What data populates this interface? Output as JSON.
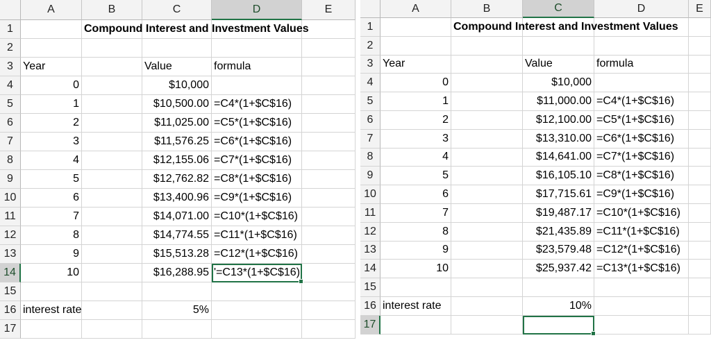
{
  "columns": [
    "A",
    "B",
    "C",
    "D",
    "E"
  ],
  "left": {
    "title": "Compound Interest and Investment Values",
    "header_year": "Year",
    "header_value": "Value",
    "header_formula": "formula",
    "rows": [
      {
        "year": "0",
        "value": "$10,000",
        "formula": ""
      },
      {
        "year": "1",
        "value": "$10,500.00",
        "formula": "=C4*(1+$C$16)"
      },
      {
        "year": "2",
        "value": "$11,025.00",
        "formula": "=C5*(1+$C$16)"
      },
      {
        "year": "3",
        "value": "$11,576.25",
        "formula": "=C6*(1+$C$16)"
      },
      {
        "year": "4",
        "value": "$12,155.06",
        "formula": "=C7*(1+$C$16)"
      },
      {
        "year": "5",
        "value": "$12,762.82",
        "formula": "=C8*(1+$C$16)"
      },
      {
        "year": "6",
        "value": "$13,400.96",
        "formula": "=C9*(1+$C$16)"
      },
      {
        "year": "7",
        "value": "$14,071.00",
        "formula": "=C10*(1+$C$16)"
      },
      {
        "year": "8",
        "value": "$14,774.55",
        "formula": "=C11*(1+$C$16)"
      },
      {
        "year": "9",
        "value": "$15,513.28",
        "formula": "=C12*(1+$C$16)"
      },
      {
        "year": "10",
        "value": "$16,288.95",
        "formula": "'=C13*(1+$C$16)"
      }
    ],
    "rate_label": "interest rate",
    "rate_value": "5%"
  },
  "right": {
    "title": "Compound Interest and Investment Values",
    "header_year": "Year",
    "header_value": "Value",
    "header_formula": "formula",
    "rows": [
      {
        "year": "0",
        "value": "$10,000",
        "formula": ""
      },
      {
        "year": "1",
        "value": "$11,000.00",
        "formula": "=C4*(1+$C$16)"
      },
      {
        "year": "2",
        "value": "$12,100.00",
        "formula": "=C5*(1+$C$16)"
      },
      {
        "year": "3",
        "value": "$13,310.00",
        "formula": "=C6*(1+$C$16)"
      },
      {
        "year": "4",
        "value": "$14,641.00",
        "formula": "=C7*(1+$C$16)"
      },
      {
        "year": "5",
        "value": "$16,105.10",
        "formula": "=C8*(1+$C$16)"
      },
      {
        "year": "6",
        "value": "$17,715.61",
        "formula": "=C9*(1+$C$16)"
      },
      {
        "year": "7",
        "value": "$19,487.17",
        "formula": "=C10*(1+$C$16)"
      },
      {
        "year": "8",
        "value": "$21,435.89",
        "formula": "=C11*(1+$C$16)"
      },
      {
        "year": "9",
        "value": "$23,579.48",
        "formula": "=C12*(1+$C$16)"
      },
      {
        "year": "10",
        "value": "$25,937.42",
        "formula": "=C13*(1+$C$16)"
      }
    ],
    "rate_label": "interest rate",
    "rate_value": "10%"
  },
  "colors": {
    "excel_green": "#217346",
    "arrow_blue": "#5b8fd6",
    "gridline": "#d4d4d4",
    "header_bg": "#f3f3f3",
    "header_selected_bg": "#d2d2d2"
  }
}
